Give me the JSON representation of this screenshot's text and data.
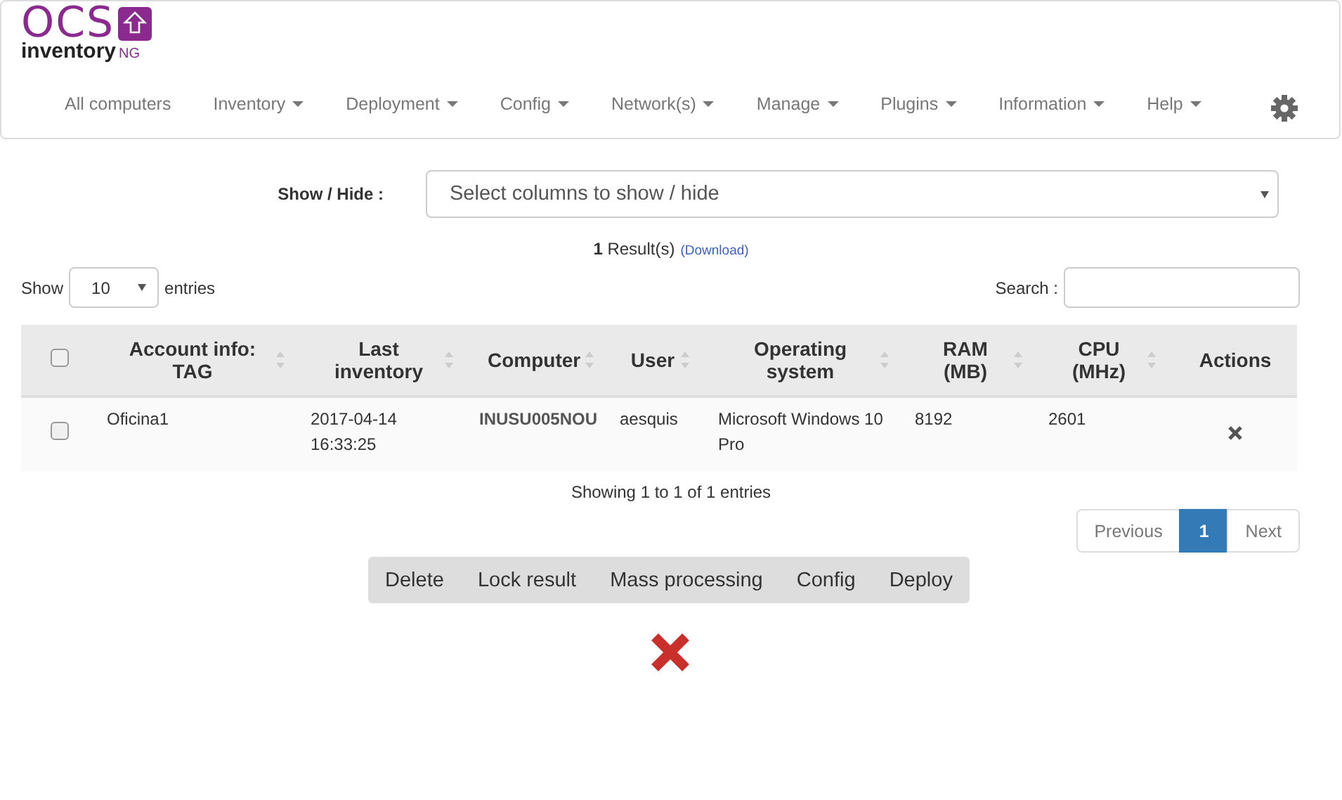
{
  "logo": {
    "top": "OCS",
    "bottom": "inventory",
    "suffix": "NG"
  },
  "nav": [
    {
      "label": "All computers",
      "dropdown": false
    },
    {
      "label": "Inventory",
      "dropdown": true
    },
    {
      "label": "Deployment",
      "dropdown": true
    },
    {
      "label": "Config",
      "dropdown": true
    },
    {
      "label": "Network(s)",
      "dropdown": true
    },
    {
      "label": "Manage",
      "dropdown": true
    },
    {
      "label": "Plugins",
      "dropdown": true
    },
    {
      "label": "Information",
      "dropdown": true
    },
    {
      "label": "Help",
      "dropdown": true
    }
  ],
  "show_hide": {
    "label": "Show / Hide :",
    "placeholder": "Select columns to show / hide"
  },
  "results": {
    "count": "1",
    "label": "Result(s)",
    "link": "(Download)"
  },
  "entries": {
    "before": "Show",
    "value": "10",
    "after": "entries"
  },
  "search": {
    "label": "Search :"
  },
  "table": {
    "header_checked": false,
    "columns": [
      {
        "label": "Account info: TAG",
        "sortable": true
      },
      {
        "label": "Last inventory",
        "sortable": true
      },
      {
        "label": "Computer",
        "sortable": true
      },
      {
        "label": "User",
        "sortable": true
      },
      {
        "label": "Operating system",
        "sortable": true
      },
      {
        "label": "RAM (MB)",
        "sortable": true
      },
      {
        "label": "CPU (MHz)",
        "sortable": true
      },
      {
        "label": "Actions",
        "sortable": false
      }
    ],
    "rows": [
      {
        "checked": false,
        "cells": [
          "Oficina1",
          "2017-04-14 16:33:25",
          "INUSU005NOU",
          "aesquis",
          "Microsoft Windows 10 Pro",
          "8192",
          "2601"
        ]
      }
    ]
  },
  "info": "Showing 1 to 1 of 1 entries",
  "pagination": [
    {
      "label": "Previous",
      "selected": false
    },
    {
      "label": "1",
      "selected": true
    },
    {
      "label": "Next",
      "selected": false
    }
  ],
  "actions": [
    "Delete",
    "Lock result",
    "Mass processing",
    "Config",
    "Deploy"
  ]
}
